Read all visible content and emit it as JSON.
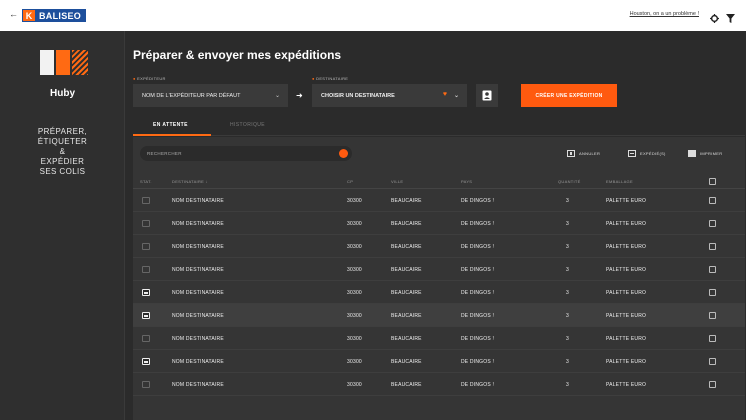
{
  "topbar": {
    "back": "←",
    "logo_mark": "K",
    "logo_text": "BALISEO",
    "help_link": "Houston, on a un problème !"
  },
  "sidebar": {
    "title": "Huby",
    "tagline_lines": [
      "PRÉPARER,",
      "ÉTIQUETER",
      "&",
      "EXPÉDIER",
      "SES COLIS"
    ]
  },
  "main": {
    "title": "Préparer & envoyer mes expéditions",
    "sender": {
      "label": "EXPÉDITEUR",
      "value": "NOM DE L'EXPÉDITEUR PAR DÉFAUT"
    },
    "recipient": {
      "label": "DESTINATAIRE",
      "value": "CHOISIR UN DESTINATAIRE"
    },
    "create_button": "CRÉER UNE EXPÉDITION",
    "tabs": [
      {
        "label": "EN ATTENTE",
        "active": true
      },
      {
        "label": "HISTORIQUE",
        "active": false
      }
    ],
    "search_placeholder": "RECHERCHER",
    "actions": {
      "cancel": "ANNULER",
      "ship": "EXPÉDIÉ(S)",
      "print": "IMPRIMER"
    },
    "columns": {
      "stat": "STAT.",
      "recipient": "DESTINATAIRE ↓",
      "cp": "CP",
      "city": "VILLE",
      "country": "PAYS",
      "qty": "QUANTITÉ",
      "packaging": "EMBALLAGE"
    },
    "rows": [
      {
        "status": "off",
        "recipient": "NOM DESTINATAIRE",
        "cp": "30300",
        "city": "BEAUCAIRE",
        "country": "DE DINGOS !",
        "qty": "3",
        "packaging": "PALETTE EURO"
      },
      {
        "status": "off",
        "recipient": "NOM DESTINATAIRE",
        "cp": "30300",
        "city": "BEAUCAIRE",
        "country": "DE DINGOS !",
        "qty": "3",
        "packaging": "PALETTE EURO"
      },
      {
        "status": "off",
        "recipient": "NOM DESTINATAIRE",
        "cp": "30300",
        "city": "BEAUCAIRE",
        "country": "DE DINGOS !",
        "qty": "3",
        "packaging": "PALETTE EURO"
      },
      {
        "status": "off",
        "recipient": "NOM DESTINATAIRE",
        "cp": "30300",
        "city": "BEAUCAIRE",
        "country": "DE DINGOS !",
        "qty": "3",
        "packaging": "PALETTE EURO"
      },
      {
        "status": "on",
        "recipient": "NOM DESTINATAIRE",
        "cp": "30300",
        "city": "BEAUCAIRE",
        "country": "DE DINGOS !",
        "qty": "3",
        "packaging": "PALETTE EURO"
      },
      {
        "status": "on",
        "recipient": "NOM DESTINATAIRE",
        "cp": "30300",
        "city": "BEAUCAIRE",
        "country": "DE DINGOS !",
        "qty": "3",
        "packaging": "PALETTE EURO",
        "highlight": true
      },
      {
        "status": "off",
        "recipient": "NOM DESTINATAIRE",
        "cp": "30300",
        "city": "BEAUCAIRE",
        "country": "DE DINGOS !",
        "qty": "3",
        "packaging": "PALETTE EURO"
      },
      {
        "status": "on",
        "recipient": "NOM DESTINATAIRE",
        "cp": "30300",
        "city": "BEAUCAIRE",
        "country": "DE DINGOS !",
        "qty": "3",
        "packaging": "PALETTE EURO"
      },
      {
        "status": "off",
        "recipient": "NOM DESTINATAIRE",
        "cp": "30300",
        "city": "BEAUCAIRE",
        "country": "DE DINGOS !",
        "qty": "3",
        "packaging": "PALETTE EURO"
      }
    ]
  },
  "colors": {
    "accent": "#ff5a0f",
    "brand_blue": "#1d4f9c"
  }
}
